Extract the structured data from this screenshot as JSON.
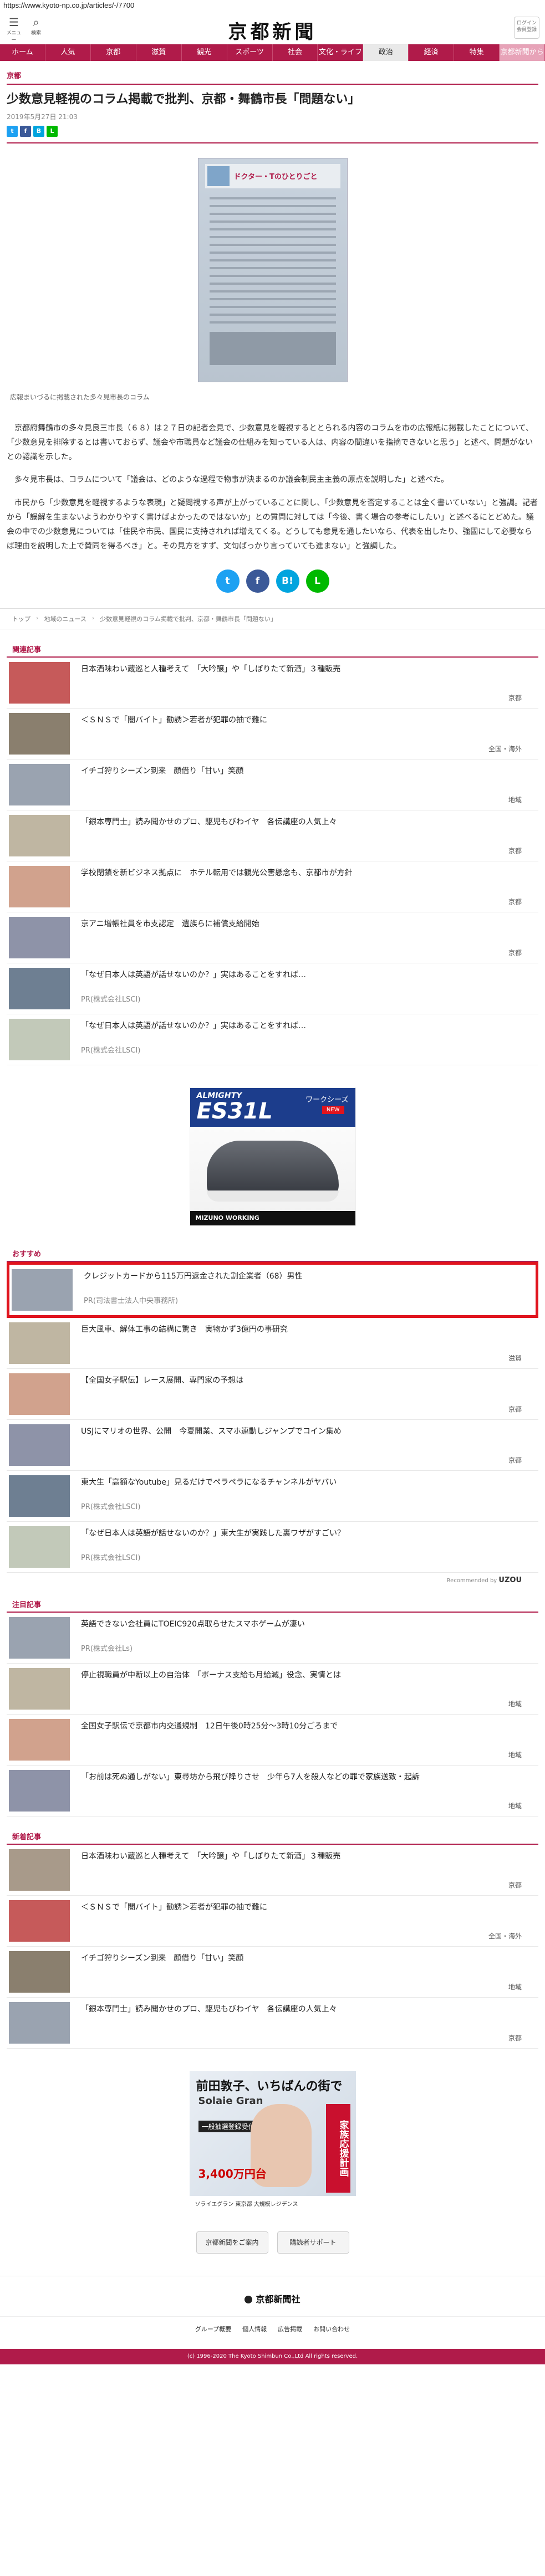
{
  "browser": {
    "url": "https://www.kyoto-np.co.jp/articles/-/7700"
  },
  "header": {
    "menu_label": "メニュー",
    "search_label": "検索",
    "logo": "京都新聞",
    "login_line1": "ログイン",
    "login_line2": "会員登録"
  },
  "nav": [
    "ホーム",
    "人気",
    "京都",
    "滋賀",
    "観光",
    "スポーツ",
    "社会",
    "文化・ライフ",
    "政治",
    "経済",
    "特集",
    "京都新聞から"
  ],
  "article": {
    "category": "京都",
    "title": "少数意見軽視のコラム掲載で批判、京都・舞鶴市長「問題ない」",
    "date": "2019年5月27日 21:03",
    "photo_heading": "ドクター・Tのひとりごと",
    "caption": "広報まいづるに掲載された多々見市長のコラム",
    "paragraphs": [
      "京都府舞鶴市の多々見良三市長（６８）は２７日の記者会見で、少数意見を軽視するととられる内容のコラムを市の広報紙に掲載したことについて、「少数意見を排除するとは書いておらず、議会や市職員など議会の仕組みを知っている人は、内容の間違いを指摘できないと思う」と述べ、問題がないとの認識を示した。",
      "多々見市長は、コラムについて「議会は、どのような過程で物事が決まるのか議会制民主主義の原点を説明した」と述べた。",
      "市民から「少数意見を軽視するような表現」と疑問視する声が上がっていることに関し、「少数意見を否定することは全く書いていない」と強調。記者から「誤解を生まないようわかりやすく書けばよかったのではないか」との質問に対しては「今後、書く場合の参考にしたい」と述べるにとどめた。議会の中での少数意見については「住民や市民、国民に支持されれば増えてくる。どうしても意見を通したいなら、代表を出したり、強固にして必要ならば理由を説明した上で賛同を得るべき」と。その見方をすず、文句ばっかり言っていても進まない」と強調した。"
    ]
  },
  "breadcrumb": [
    "トップ",
    "地域のニュース",
    "少数意見軽視のコラム掲載で批判、京都・舞鶴市長「問題ない」"
  ],
  "related": {
    "title": "関連記事",
    "items": [
      {
        "text": "日本酒味わい蔵巡と人種考えて　「大吟醸」や「しぼりたて新酒」３種販売",
        "tag": "京都"
      },
      {
        "text": "＜ＳＮＳで「闇バイト」勧誘＞若者が犯罪の抽で難に",
        "tag": "全国・海外"
      },
      {
        "text": "イチゴ狩りシーズン到来　顔借り「甘い」笑顔",
        "tag": "地域"
      },
      {
        "text": "「銀本専門士」読み聞かせのプロ、駆児もびわイヤ　各伝講座の人気上々",
        "tag": "京都"
      },
      {
        "text": "学校閉鎖を新ビジネス拠点に　ホテル転用では観光公害懸念も、京都市が方針",
        "tag": "京都"
      },
      {
        "text": "京アニ増帳社員を市支認定　遺族らに補償支給開始",
        "tag": "京都"
      },
      {
        "text": "「なぜ日本人は英語が話せないのか？」実はあることをすれば…",
        "sub": "PR(株式会社LSCI)",
        "tag": ""
      },
      {
        "text": "「なぜ日本人は英語が話せないのか？」実はあることをすれば…",
        "sub": "PR(株式会社LSCI)",
        "tag": ""
      }
    ]
  },
  "ad_shoe": {
    "brand": "ALMIGHTY",
    "model": "ES31L",
    "line": "ワークシーズ",
    "badge": "NEW",
    "footer": "MIZUNO WORKING"
  },
  "recommend": {
    "title": "おすすめ",
    "items": [
      {
        "text": "クレジットカードから115万円返金された割企業者（68）男性",
        "sub": "PR(司法書士法人中央事務所)",
        "tag": ""
      },
      {
        "text": "巨大風車、解体工事の結構に驚き　実物かず3億円の事研究",
        "tag": "滋賀"
      },
      {
        "text": "【全国女子駅伝】レース展開、専門家の予想は",
        "tag": "京都"
      },
      {
        "text": "USJにマリオの世界、公開　今夏開業、スマホ連動しジャンプでコイン集め",
        "tag": "京都"
      },
      {
        "text": "東大生「高額なYoutube」見るだけでペラペラになるチャンネルがヤバい",
        "sub": "PR(株式会社LSCI)",
        "tag": ""
      },
      {
        "text": "「なぜ日本人は英語が話せないのか？」東大生が実践した裏ワザがすごい？",
        "sub": "PR(株式会社LSCI)",
        "tag": ""
      }
    ],
    "recommended_by": "Recommended by",
    "provider": "UZOU"
  },
  "attention": {
    "title": "注目記事",
    "items": [
      {
        "text": "英語できない会社員にTOEIC920点取らせたスマホゲームが凄い",
        "sub": "PR(株式会社Ls)",
        "tag": ""
      },
      {
        "text": "停止視職員が中断以上の自治体　「ボーナス支給も月給減」役念、実情とは",
        "tag": "地域"
      },
      {
        "text": "全国女子駅伝で京都市内交通規制　12日午後0時25分～3時10分ごろまで",
        "tag": "地域"
      },
      {
        "text": "「お前は死ぬ通しがない」東尋坊から飛び降りさせ　少年ら7人を殺人などの罪で家族送致・起訴",
        "tag": "地域"
      }
    ]
  },
  "latest": {
    "title": "新着記事",
    "items": [
      {
        "text": "日本酒味わい蔵巡と人種考えて　「大吟醸」や「しぼりたて新酒」３種販売",
        "tag": "京都"
      },
      {
        "text": "＜ＳＮＳで「闇バイト」勧誘＞若者が犯罪の抽で難に",
        "tag": "全国・海外"
      },
      {
        "text": "イチゴ狩りシーズン到来　顔借り「甘い」笑顔",
        "tag": "地域"
      },
      {
        "text": "「銀本専門士」読み聞かせのプロ、駆児もびわイヤ　各伝講座の人気上々",
        "tag": "京都"
      }
    ]
  },
  "ad_bottom": {
    "line1": "前田敦子、いちばんの街で",
    "line2": "Solaie Gran",
    "line3": "一般抽選登録受付中",
    "price": "3,400万円台",
    "side": "家族応援計画",
    "footer": "ソライエグラン 東京都 大規模レジデンス"
  },
  "buttons": [
    "京都新聞をご案内",
    "購読者サポート"
  ],
  "footer": {
    "logo": "京都新聞社",
    "links": [
      "グループ概要",
      "個人情報",
      "広告掲載",
      "お問い合わせ"
    ],
    "copyright": "(c) 1996-2020 The Kyoto Shimbun Co.,Ltd All rights reserved."
  },
  "colors": {
    "brand": "#b01b4a",
    "highlight": "#e0141e"
  }
}
